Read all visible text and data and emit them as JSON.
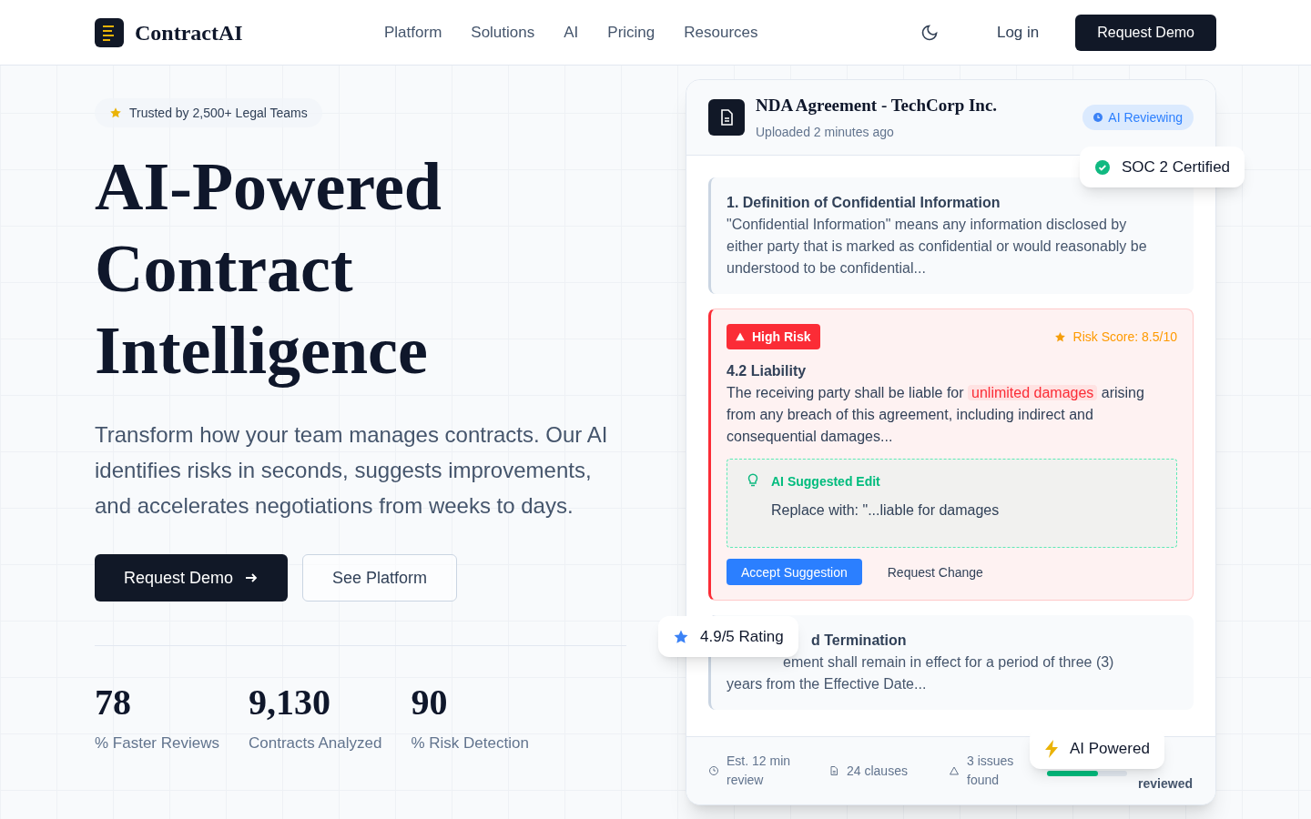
{
  "nav": {
    "logo": "ContractAI",
    "links": [
      "Platform",
      "Solutions",
      "AI",
      "Pricing",
      "Resources"
    ],
    "login": "Log in",
    "cta": "Request Demo"
  },
  "hero": {
    "badge": "Trusted by 2,500+ Legal Teams",
    "title": "AI-Powered Contract Intelligence",
    "description": "Transform how your team manages contracts. Our AI identifies risks in seconds, suggests improvements, and accelerates negotiations from weeks to days.",
    "buttons": [
      {
        "label": "Request Demo",
        "kind": "primary"
      },
      {
        "label": "See Platform",
        "kind": "secondary"
      }
    ],
    "stats": [
      {
        "value": "78",
        "label": "% Faster Reviews"
      },
      {
        "value": "9,130",
        "label": "Contracts Analyzed"
      },
      {
        "value": "90",
        "label": "% Risk Detection"
      }
    ]
  },
  "document": {
    "title": "NDA Agreement - TechCorp Inc.",
    "subtitle": "Uploaded 2 minutes ago",
    "status": "AI Reviewing",
    "clauses": [
      {
        "kind": "plain",
        "title": "1. Definition of Confidential Information",
        "body": {
          "before": "\"Confidential Information\" means any information disclosed by either party that is marked as confidential or would reasonably be understood to be confidential..."
        }
      },
      {
        "kind": "risk",
        "risk_label": "High Risk",
        "risk_score": "Risk Score: 8.5/10",
        "title": "4.2 Liability",
        "body": {
          "before": "The receiving party shall be liable for ",
          "highlighted": "unlimited damages",
          "after": " arising from any breach of this agreement, including indirect and consequential damages..."
        },
        "suggestion": {
          "label": "AI Suggested Edit",
          "text": "Replace with: \"...liable for damages"
        },
        "actions": [
          {
            "label": "Accept Suggestion",
            "kind": "primary"
          },
          {
            "label": "Request Change",
            "kind": "secondary"
          }
        ]
      },
      {
        "kind": "covered",
        "title": "d Termination",
        "body": [
          "ement shall remain in effect for a period of three (3)",
          "years from the Effective Date..."
        ]
      }
    ],
    "footer": [
      {
        "kind": "clock",
        "text": "Est. 12 min review"
      },
      {
        "kind": "file",
        "text": "24 clauses"
      },
      {
        "kind": "warning",
        "text": "3 issues found"
      }
    ],
    "progress": {
      "level": 0.64,
      "label": "reviewed"
    }
  },
  "floating_badges": [
    {
      "kind": "check",
      "text": "SOC 2 Certified"
    },
    {
      "kind": "star",
      "text": "4.9/5 Rating"
    },
    {
      "kind": "bolt",
      "text": "AI Powered"
    }
  ]
}
